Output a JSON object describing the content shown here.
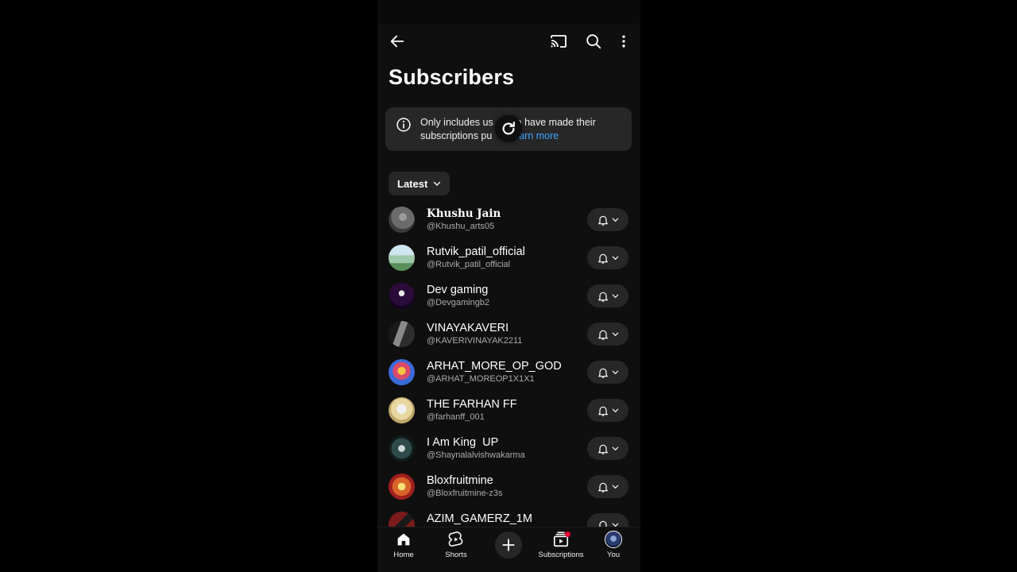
{
  "header": {
    "title": "Subscribers",
    "back_icon": "arrow-left-icon",
    "cast_icon": "cast-icon",
    "search_icon": "search-icon",
    "more_icon": "more-vertical-icon"
  },
  "notice": {
    "text_prefix": "Only includes us",
    "text_mid": "ho have made their subscriptions pu",
    "link": "Learn more",
    "icon": "info-icon"
  },
  "sort": {
    "label": "Latest"
  },
  "subscribers": [
    {
      "name": "Khushu Jain",
      "handle": "@Khushu_arts05",
      "avatar_color": "#6b6b6b"
    },
    {
      "name": "Rutvik_patil_official",
      "handle": "@Rutvik_patil_official",
      "avatar_color": "#9fc9a8"
    },
    {
      "name": "Dev gaming",
      "handle": "@Devgamingb2",
      "avatar_color": "#2a0b3a"
    },
    {
      "name": "VINAYAKAVERI",
      "handle": "@KAVERIVINAYAK2211",
      "avatar_color": "#3a3a3a"
    },
    {
      "name": "ARHAT_MORE_OP_GOD",
      "handle": "@ARHAT_MOREOP1X1X1",
      "avatar_color": "#d94a6a"
    },
    {
      "name": "THE FARHAN FF",
      "handle": "@farhanff_001",
      "avatar_color": "#e8d6a0"
    },
    {
      "name": "I Am King  UP",
      "handle": "@Shaynalalvishwakarma",
      "avatar_color": "#2f4a4a"
    },
    {
      "name": "Bloxfruitmine",
      "handle": "@Bloxfruitmine-z3s",
      "avatar_color": "#d9642a"
    },
    {
      "name": "AZIM_GAMERZ_1M",
      "handle": "",
      "avatar_color": "#7a1a1a"
    }
  ],
  "nav": {
    "home": "Home",
    "shorts": "Shorts",
    "subscriptions": "Subscriptions",
    "you": "You"
  }
}
